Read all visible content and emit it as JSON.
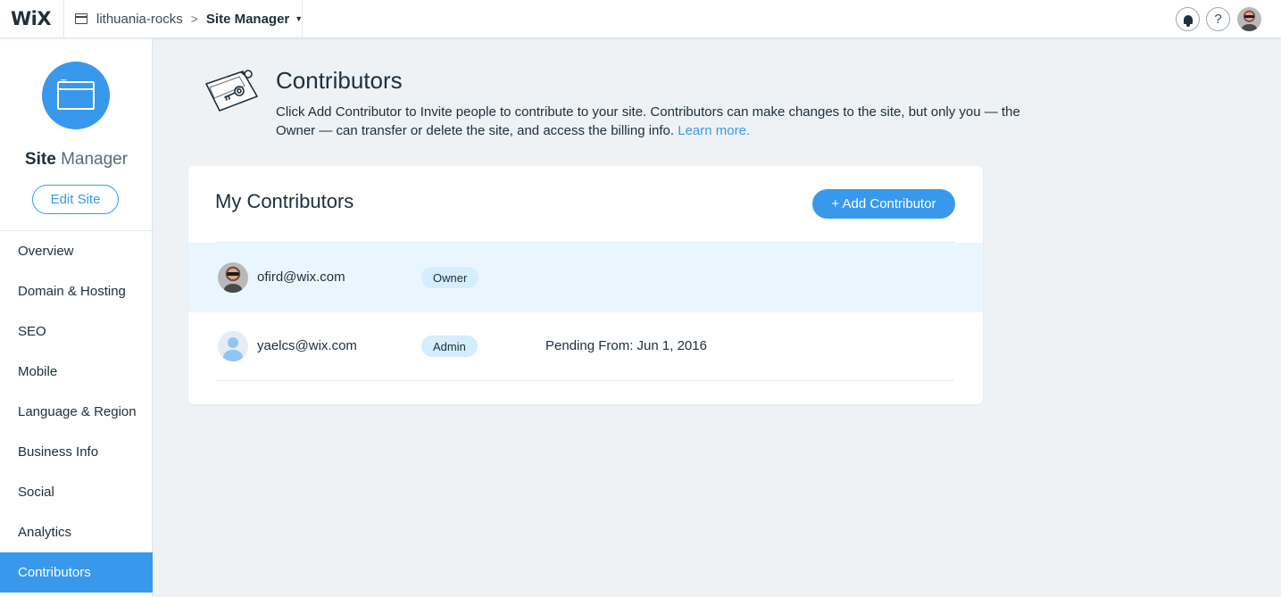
{
  "topbar": {
    "logo": "WiX",
    "site_name": "lithuania-rocks",
    "separator": ">",
    "current_page": "Site Manager",
    "help_label": "?"
  },
  "sidebar": {
    "title_bold": "Site",
    "title_light": "Manager",
    "edit_button": "Edit Site",
    "items": [
      {
        "label": "Overview",
        "active": false
      },
      {
        "label": "Domain & Hosting",
        "active": false
      },
      {
        "label": "SEO",
        "active": false
      },
      {
        "label": "Mobile",
        "active": false
      },
      {
        "label": "Language & Region",
        "active": false
      },
      {
        "label": "Business Info",
        "active": false
      },
      {
        "label": "Social",
        "active": false
      },
      {
        "label": "Analytics",
        "active": false
      },
      {
        "label": "Contributors",
        "active": true
      }
    ]
  },
  "main": {
    "title": "Contributors",
    "description": "Click Add Contributor to Invite people to contribute to your site. Contributors can make changes to the site, but only you — the Owner — can transfer or delete the site, and access the billing info.",
    "learn_more": "Learn more."
  },
  "card": {
    "title": "My Contributors",
    "add_button": "+ Add Contributor",
    "rows": [
      {
        "email": "ofird@wix.com",
        "role": "Owner",
        "pending": ""
      },
      {
        "email": "yaelcs@wix.com",
        "role": "Admin",
        "pending": "Pending From: Jun 1, 2016"
      }
    ]
  },
  "colors": {
    "accent": "#3899ec",
    "background": "#eef2f5",
    "highlight_row": "#eaf6ff",
    "badge": "#d4edff"
  },
  "icons": [
    "site-icon",
    "caret-down-icon",
    "bell-icon",
    "help-icon",
    "user-avatar-icon",
    "site-manager-window-icon",
    "contributors-key-icon",
    "default-user-icon"
  ]
}
